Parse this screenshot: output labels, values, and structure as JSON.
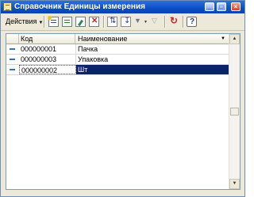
{
  "window": {
    "title": "Справочник Единицы измерения",
    "buttons": {
      "minimize": "_",
      "maximize": "□",
      "close": "×"
    }
  },
  "toolbar": {
    "actions_label": "Действия",
    "icons": [
      "add-icon",
      "copy-icon",
      "edit-icon",
      "delete-icon",
      "sort-icon",
      "sort-down-icon",
      "filter-icon",
      "filter-off-icon",
      "refresh-icon",
      "help-icon"
    ]
  },
  "table": {
    "columns": [
      "Код",
      "Наименование"
    ],
    "rows": [
      {
        "code": "000000001",
        "name": "Пачка"
      },
      {
        "code": "000000003",
        "name": "Упаковка"
      },
      {
        "code": "000000002",
        "name": "Шт"
      }
    ],
    "selected_row": 2
  },
  "colors": {
    "title_bar": "#0a4fc8",
    "selection": "#0a246a",
    "row_marker": "#3470c8"
  }
}
